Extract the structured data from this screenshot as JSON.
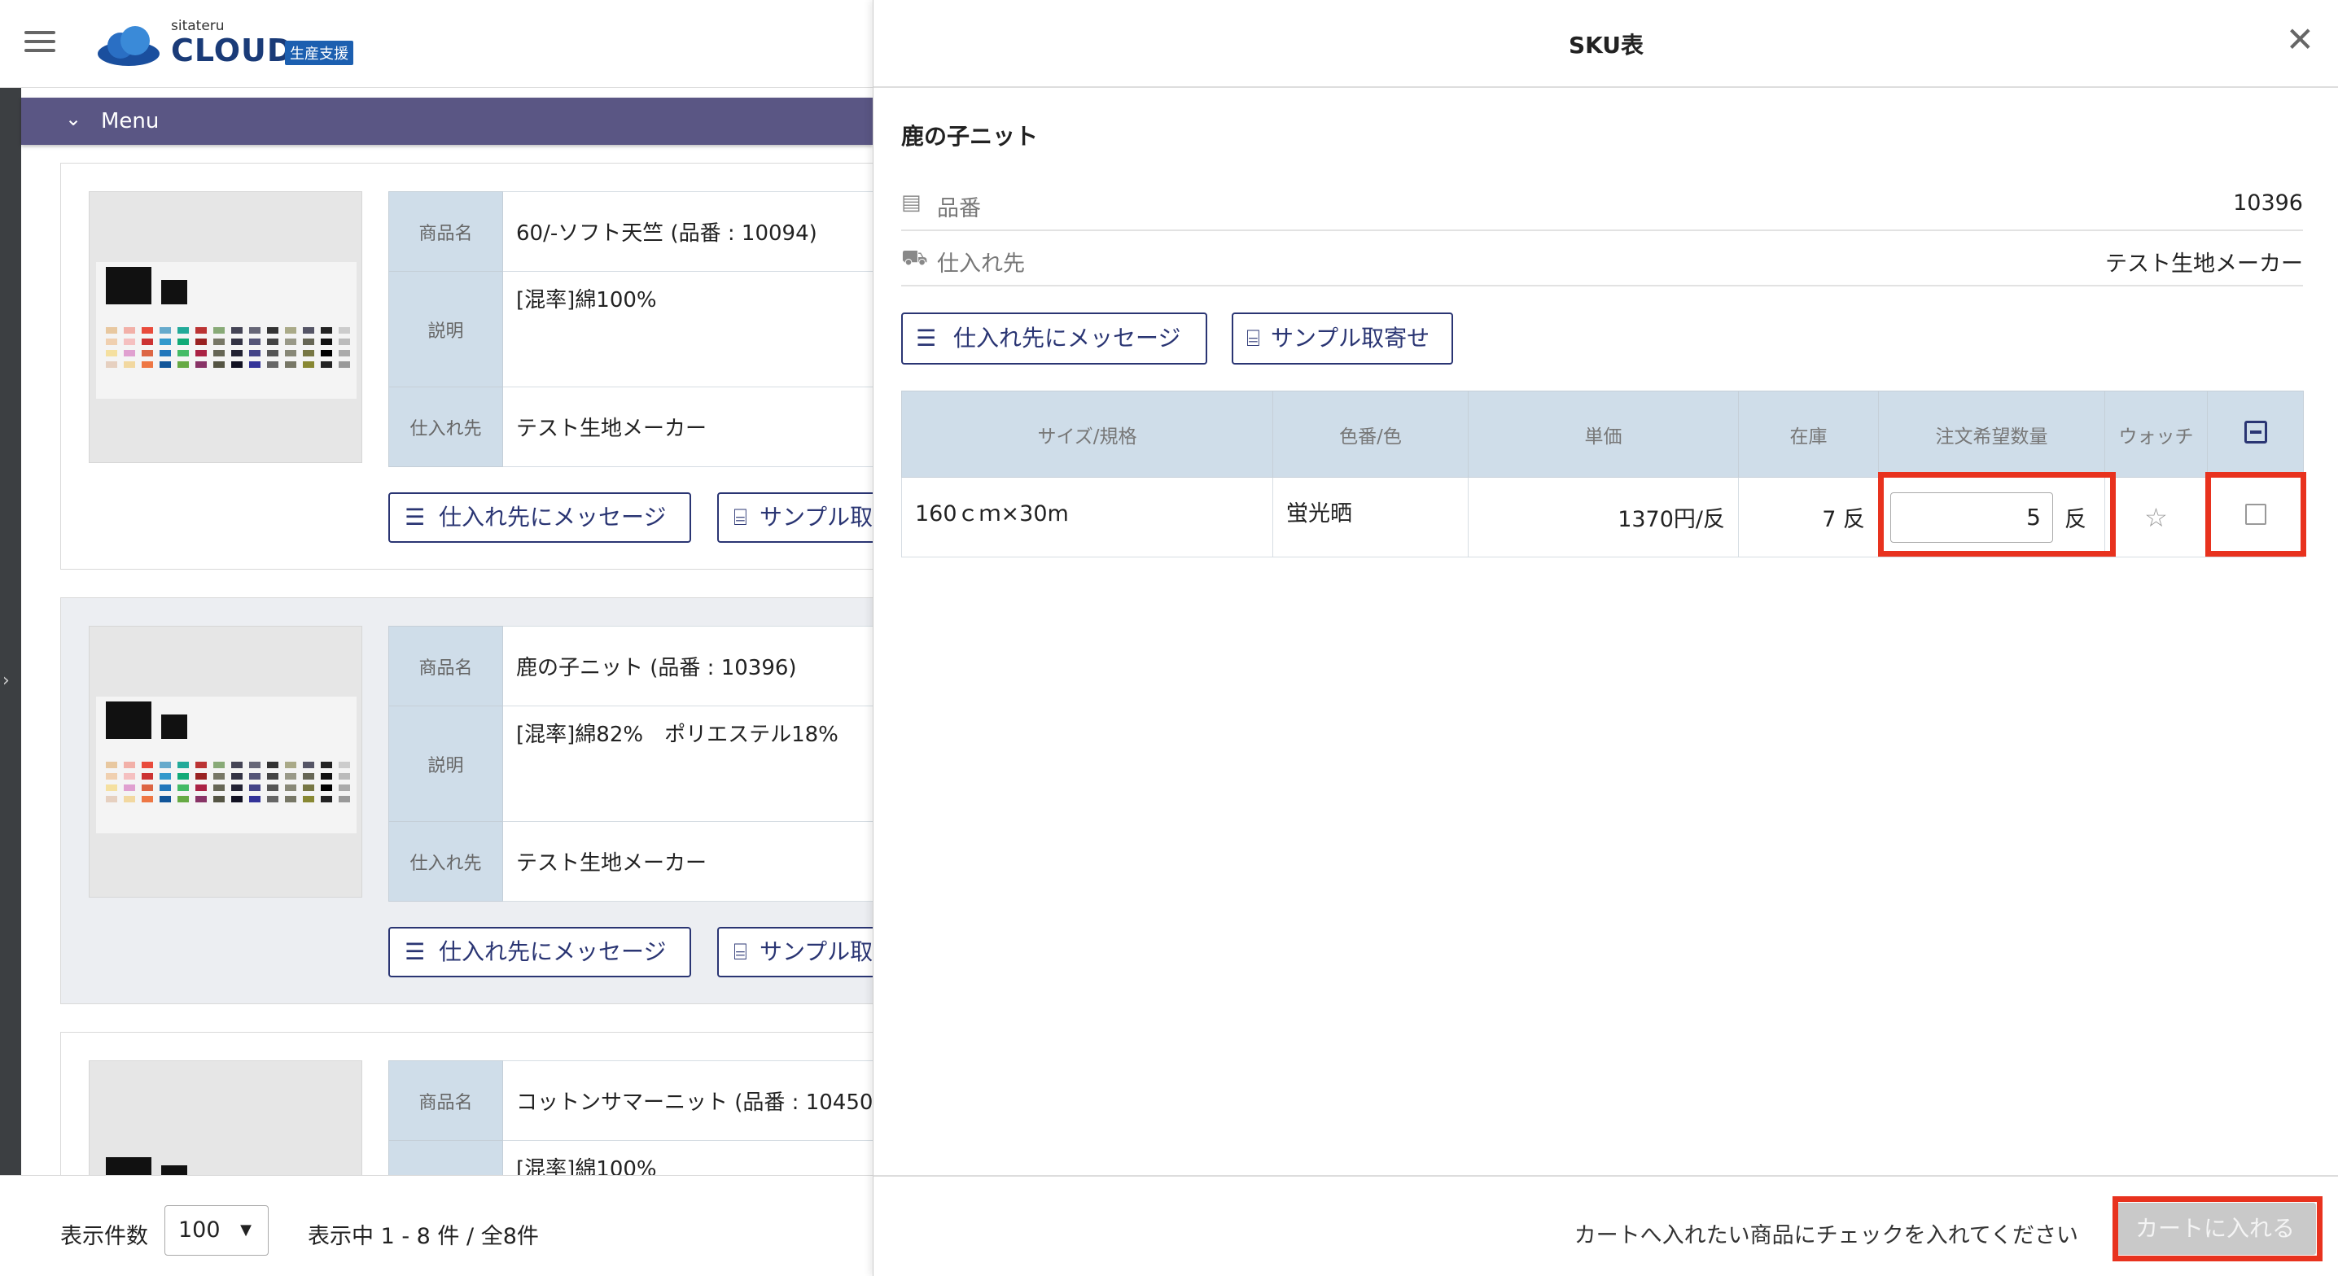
{
  "app": {
    "logo_small": "sitateru",
    "logo_main": "CLOUD",
    "logo_badge": "生産支援",
    "menu_label": "Menu"
  },
  "products": [
    {
      "label_name": "商品名",
      "name": "60/-ソフト天竺 (品番 : 10094)",
      "label_desc": "説明",
      "desc": "[混率]綿100%",
      "label_supplier": "仕入れ先",
      "supplier": "テスト生地メーカー",
      "message_btn": "仕入れ先にメッセージ",
      "sample_btn": "サンプル取"
    },
    {
      "label_name": "商品名",
      "name": "鹿の子ニット (品番 : 10396)",
      "label_desc": "説明",
      "desc": "[混率]綿82%　ポリエステル18%",
      "label_supplier": "仕入れ先",
      "supplier": "テスト生地メーカー",
      "message_btn": "仕入れ先にメッセージ",
      "sample_btn": "サンプル取"
    },
    {
      "label_name": "商品名",
      "name": "コットンサマーニット (品番 : 10450",
      "desc": "[混率]綿100%"
    }
  ],
  "pagination": {
    "per_page_label": "表示件数",
    "per_page_value": "100",
    "range_text": "表示中 1 - 8 件 / 全8件"
  },
  "dialog": {
    "title": "SKU表",
    "product_name": "鹿の子ニット",
    "part_number_label": "品番",
    "part_number_value": "10396",
    "supplier_label": "仕入れ先",
    "supplier_value": "テスト生地メーカー",
    "message_btn": "仕入れ先にメッセージ",
    "sample_btn": "サンプル取寄せ",
    "table": {
      "headers": [
        "サイズ/規格",
        "色番/色",
        "単価",
        "在庫",
        "注文希望数量",
        "ウォッチ"
      ],
      "rows": [
        {
          "size": "160ｃｍ×30m",
          "color": "蛍光晒",
          "price": "1370円/反",
          "stock": "7 反",
          "quantity": "5",
          "quantity_unit": "反"
        }
      ]
    },
    "cart_hint": "カートへ入れたい商品にチェックを入れてください",
    "cart_button": "カートに入れる"
  },
  "icons": {
    "menu": "hamburger-icon",
    "close": "close-icon",
    "message": "chat-icon",
    "sample": "spool-icon",
    "part_number": "document-icon",
    "supplier": "truck-icon",
    "watch": "star-icon"
  },
  "colors": {
    "accent": "#2a3573",
    "menu_bar": "#5a5684",
    "table_header": "#cfdde9",
    "highlight": "#e8321e"
  }
}
